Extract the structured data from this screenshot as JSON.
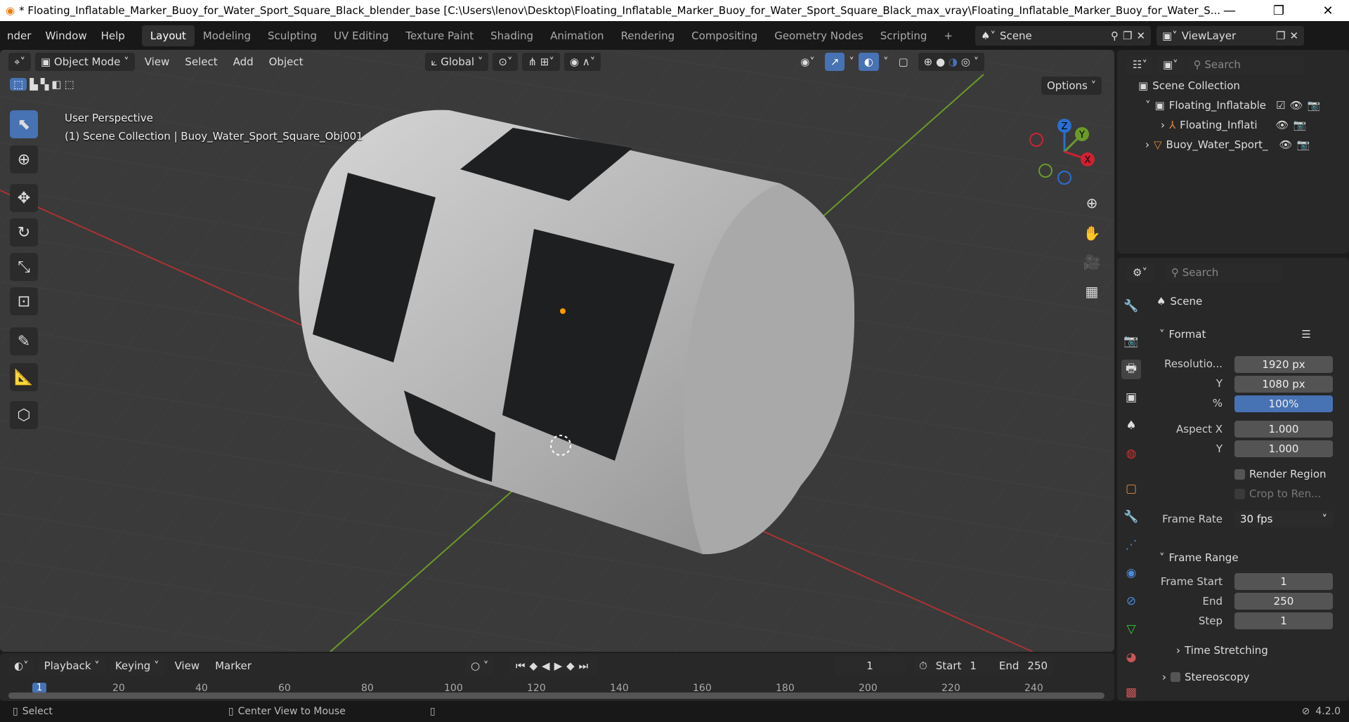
{
  "window": {
    "title": "* Floating_Inflatable_Marker_Buoy_for_Water_Sport_Square_Black_blender_base [C:\\Users\\lenov\\Desktop\\Floating_Inflatable_Marker_Buoy_for_Water_Sport_Square_Black_max_vray\\Floating_Inflatable_Marker_Buoy_for_Water_S...",
    "minimize": "—",
    "restore": "❐",
    "close": "✕"
  },
  "menu": {
    "items": [
      "nder",
      "Window",
      "Help"
    ]
  },
  "workspaces": [
    "Layout",
    "Modeling",
    "Sculpting",
    "UV Editing",
    "Texture Paint",
    "Shading",
    "Animation",
    "Rendering",
    "Compositing",
    "Geometry Nodes",
    "Scripting",
    "+"
  ],
  "scene": {
    "name": "Scene",
    "view_layer": "ViewLayer"
  },
  "viewport": {
    "mode": "Object Mode",
    "menus": [
      "View",
      "Select",
      "Add",
      "Object"
    ],
    "transform_orientation": "Global",
    "options": "Options",
    "perspective": "User Perspective",
    "collection_info": "(1) Scene Collection | Buoy_Water_Sport_Square_Obj001",
    "gizmo": {
      "z": "Z",
      "y": "Y",
      "x": "X"
    }
  },
  "outliner": {
    "search_placeholder": "Search",
    "root": "Scene Collection",
    "items": [
      "Floating_Inflatable",
      "Floating_Inflati",
      "Buoy_Water_Sport_"
    ]
  },
  "properties": {
    "search_placeholder": "Search",
    "context": "Scene",
    "format": {
      "title": "Format",
      "resolution_label": "Resolutio...",
      "res_x": "1920 px",
      "y_label": "Y",
      "res_y": "1080 px",
      "pct_label": "%",
      "pct": "100%",
      "aspect_label": "Aspect X",
      "aspect_x": "1.000",
      "aspect_y_label": "Y",
      "aspect_y": "1.000",
      "render_region": "Render Region",
      "crop": "Crop to Ren...",
      "frame_rate_label": "Frame Rate",
      "frame_rate": "30 fps"
    },
    "frame_range": {
      "title": "Frame Range",
      "start_label": "Frame Start",
      "start": "1",
      "end_label": "End",
      "end": "250",
      "step_label": "Step",
      "step": "1"
    },
    "time_stretching": "Time Stretching",
    "stereoscopy": "Stereoscopy"
  },
  "timeline": {
    "menus": [
      "Playback",
      "Keying",
      "View",
      "Marker"
    ],
    "current_frame": "1",
    "start_label": "Start",
    "start": "1",
    "end_label": "End",
    "end": "250",
    "ticks": [
      "20",
      "40",
      "60",
      "80",
      "100",
      "120",
      "140",
      "160",
      "180",
      "200",
      "220",
      "240"
    ],
    "playhead": "1"
  },
  "status": {
    "select": "Select",
    "center": "Center View to Mouse",
    "version": "4.2.0"
  }
}
